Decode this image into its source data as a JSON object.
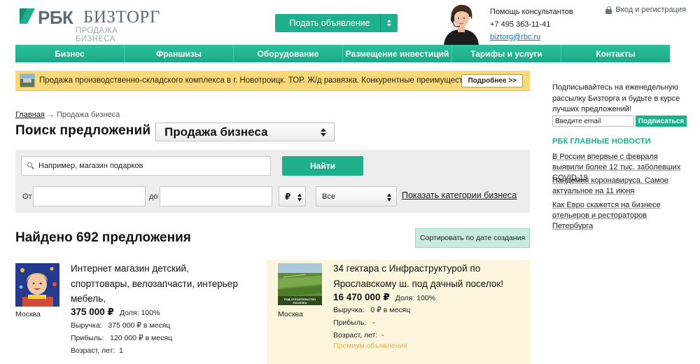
{
  "header": {
    "logo_main": "РБК",
    "logo_brand": "БИЗТОРГ",
    "logo_sub": "ПРОДАЖА БИЗНЕСА",
    "post_ad_label": "Подать объявление",
    "help_title": "Помощь консультантов",
    "help_phone": "+7 495 363-11-41",
    "help_email": "biztorg@rbc.ru",
    "login_label": "Вход и регистрация"
  },
  "nav": {
    "items": [
      {
        "label": "Бизнес"
      },
      {
        "label": "Франшизы"
      },
      {
        "label": "Оборудование"
      },
      {
        "label": "Размещение инвестиций"
      },
      {
        "label": "Тарифы и услуги"
      },
      {
        "label": "Контакты"
      }
    ]
  },
  "promo": {
    "text": "Продажа производственно-складского комплекса в г. Новотроицк. ТОР. Ж/д развязка. Конкурентные преимущества!",
    "button": "Подробнее >>"
  },
  "breadcrumb": {
    "home": "Главная",
    "separator": "→",
    "current": "Продажа бизнеса"
  },
  "search": {
    "title": "Поиск предложений",
    "type_selected": "Продажа бизнеса",
    "query_placeholder": "Например, магазин подарков",
    "find_label": "Найти",
    "from_label": "От",
    "to_label": "до",
    "currency_selected": "₽",
    "category_selected": "Все",
    "show_categories": "Показать категории бизнеса"
  },
  "results": {
    "found_text": "Найдено 692 предложения",
    "sort_label": "Сортировать по дате создания"
  },
  "listings": [
    {
      "title_line1": "Интернет магазин детский,",
      "title_line2": "спорттовары, велозапчасти, интерьер",
      "title_line3": "мебель,",
      "city": "Москва",
      "price": "375 000 ₽",
      "share": "Доля: 100%",
      "revenue_label": "Выручка:",
      "revenue_value": "375 000 ₽ в месяц",
      "profit_label": "Прибыль:",
      "profit_value": "120 000 ₽ в месяц",
      "age_label": "Возраст, лет:",
      "age_value": "1"
    },
    {
      "title_line1": "34 гектара с Инфраструктурой по",
      "title_line2": "Ярославскому ш. под дачный поселок!",
      "city": "Москва",
      "price": "16 470 000 ₽",
      "share": "Доля: 100%",
      "revenue_label": "Выручка:",
      "revenue_value": "0 ₽ в месяц",
      "profit_label": "Прибыль:",
      "profit_value": "-",
      "age_label": "Возраст, лет:",
      "age_value": "-",
      "premium": "Премиум объявления",
      "image_caption": "ПОД СТРОИТЕЛЬСТВО ПОСЕЛКА"
    }
  ],
  "sidebar": {
    "subscribe_text": "Подписывайтесь на еженедельную рассылку Бизторга и будьте в курсе лучших предложений!",
    "email_placeholder": "Введите email",
    "subscribe_button": "Подписаться",
    "news_title": "РБК ГЛАВНЫЕ НОВОСТИ",
    "news": [
      {
        "text": "В России впервые с февраля выявили более 12 тыс. заболевших COVID-19"
      },
      {
        "text": "Пандемия коронавируса. Самое актуальное на 11 июня"
      },
      {
        "text": "Как Евро скажется на бизнесе отельеров и рестораторов Петербурга"
      }
    ]
  },
  "colors": {
    "accent": "#1eaf8c",
    "promo": "#fbd97a",
    "premium_bg": "#fdf5dc",
    "link": "#1f6fb5"
  }
}
